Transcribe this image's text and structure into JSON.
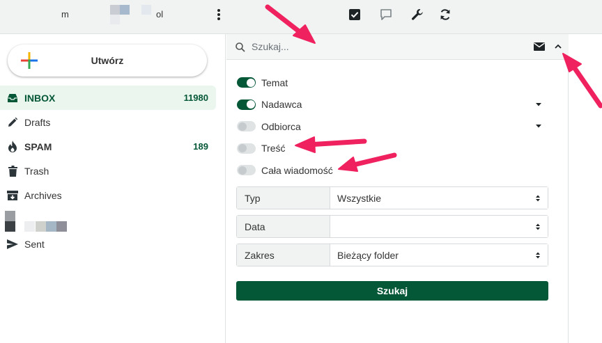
{
  "topbar": {
    "account_left": "m",
    "account_right": "ol",
    "icons": [
      "more-vertical-icon",
      "checkbox-checked-icon",
      "chat-bubble-icon",
      "wrench-icon",
      "refresh-icon"
    ]
  },
  "sidebar": {
    "compose_label": "Utwórz",
    "folders": [
      {
        "label": "INBOX",
        "count": "11980",
        "icon": "inbox-icon"
      },
      {
        "label": "Drafts",
        "count": "",
        "icon": "pencil-icon"
      },
      {
        "label": "SPAM",
        "count": "189",
        "icon": "fire-icon"
      },
      {
        "label": "Trash",
        "count": "",
        "icon": "trash-icon"
      },
      {
        "label": "Archives",
        "count": "",
        "icon": "archive-icon"
      },
      {
        "label": "Sent",
        "count": "",
        "icon": "send-icon"
      }
    ]
  },
  "search": {
    "placeholder": "Szukaj...",
    "options": [
      {
        "label": "Temat",
        "on": true
      },
      {
        "label": "Nadawca",
        "on": true
      },
      {
        "label": "Odbiorca",
        "on": false
      },
      {
        "label": "Treść",
        "on": false
      },
      {
        "label": "Cała wiadomość",
        "on": false
      }
    ],
    "fields": [
      {
        "label": "Typ",
        "value": "Wszystkie"
      },
      {
        "label": "Data",
        "value": ""
      },
      {
        "label": "Zakres",
        "value": "Bieżący folder"
      }
    ],
    "submit_label": "Szukaj"
  },
  "colors": {
    "accent": "#055837",
    "annotation_arrow": "#f0215f"
  }
}
